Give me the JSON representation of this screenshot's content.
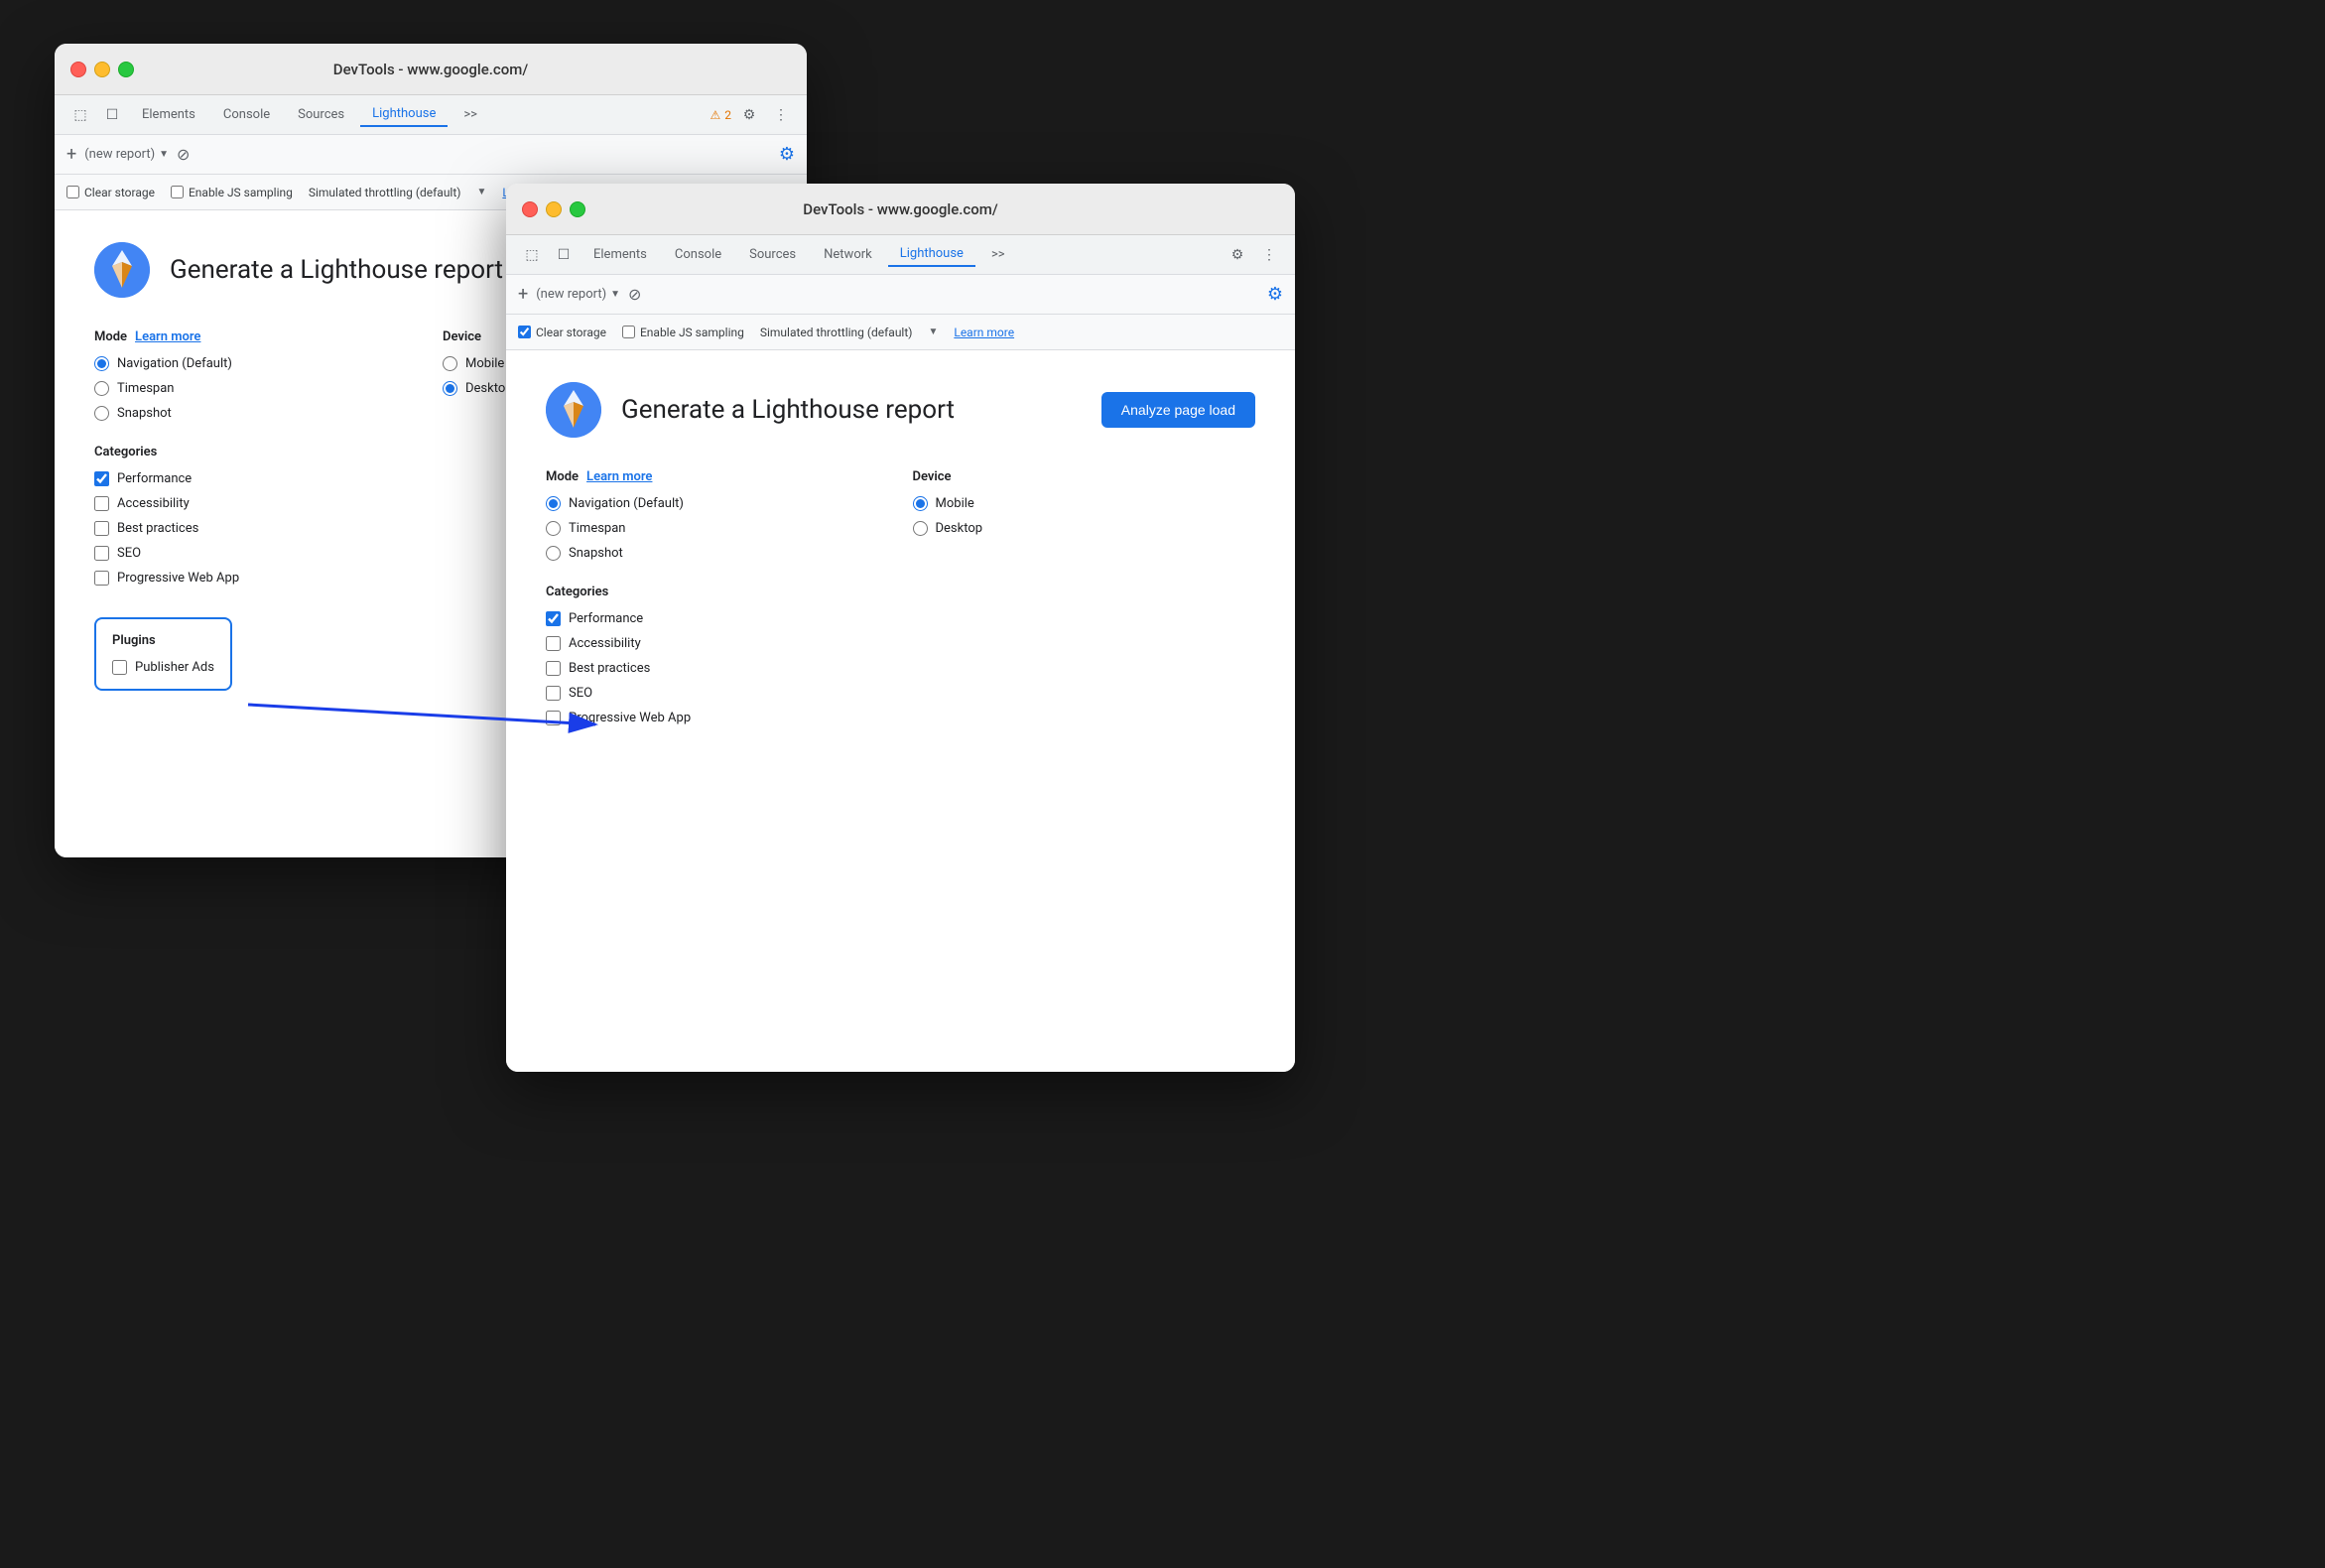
{
  "window1": {
    "titlebar": {
      "title": "DevTools - www.google.com/"
    },
    "tabs": {
      "items": [
        "Elements",
        "Console",
        "Sources",
        "Lighthouse",
        ">>"
      ],
      "active": "Lighthouse"
    },
    "warning": {
      "count": "2"
    },
    "lh_toolbar": {
      "new_report": "(new report)",
      "plus": "+",
      "clear": "⊘"
    },
    "options_bar": {
      "clear_storage": "Clear storage",
      "clear_storage_checked": false,
      "enable_js": "Enable JS sampling",
      "enable_js_checked": false,
      "throttling": "Simulated throttling (default)",
      "learn_more": "Learn more"
    },
    "main": {
      "title": "Generate a Lighthouse report",
      "mode_label": "Mode",
      "mode_learn_more": "Learn more",
      "device_label": "Device",
      "modes": [
        {
          "label": "Navigation (Default)",
          "checked": true
        },
        {
          "label": "Timespan",
          "checked": false
        },
        {
          "label": "Snapshot",
          "checked": false
        }
      ],
      "devices": [
        {
          "label": "Mobile",
          "checked": false
        },
        {
          "label": "Desktop",
          "checked": true
        }
      ],
      "categories_label": "Categories",
      "categories": [
        {
          "label": "Performance",
          "checked": true
        },
        {
          "label": "Accessibility",
          "checked": false
        },
        {
          "label": "Best practices",
          "checked": false
        },
        {
          "label": "SEO",
          "checked": false
        },
        {
          "label": "Progressive Web App",
          "checked": false
        }
      ],
      "plugins_label": "Plugins",
      "plugins": [
        {
          "label": "Publisher Ads",
          "checked": false
        }
      ]
    }
  },
  "window2": {
    "titlebar": {
      "title": "DevTools - www.google.com/"
    },
    "tabs": {
      "items": [
        "Elements",
        "Console",
        "Sources",
        "Network",
        "Lighthouse",
        ">>"
      ],
      "active": "Lighthouse"
    },
    "lh_toolbar": {
      "new_report": "(new report)",
      "plus": "+",
      "clear": "⊘"
    },
    "options_bar": {
      "clear_storage": "Clear storage",
      "clear_storage_checked": true,
      "enable_js": "Enable JS sampling",
      "enable_js_checked": false,
      "throttling": "Simulated throttling (default)",
      "learn_more": "Learn more"
    },
    "main": {
      "title": "Generate a Lighthouse report",
      "analyze_btn": "Analyze page load",
      "mode_label": "Mode",
      "mode_learn_more": "Learn more",
      "device_label": "Device",
      "modes": [
        {
          "label": "Navigation (Default)",
          "checked": true
        },
        {
          "label": "Timespan",
          "checked": false
        },
        {
          "label": "Snapshot",
          "checked": false
        }
      ],
      "devices": [
        {
          "label": "Mobile",
          "checked": true
        },
        {
          "label": "Desktop",
          "checked": false
        }
      ],
      "categories_label": "Categories",
      "categories": [
        {
          "label": "Performance",
          "checked": true
        },
        {
          "label": "Accessibility",
          "checked": false
        },
        {
          "label": "Best practices",
          "checked": false
        },
        {
          "label": "SEO",
          "checked": false
        },
        {
          "label": "Progressive Web App",
          "checked": false
        }
      ]
    }
  },
  "icons": {
    "gear": "⚙",
    "kebab": "⋮",
    "warning": "⚠",
    "cursor": "⬚",
    "inspector": "☐",
    "add": "+",
    "chevron_down": "▼",
    "circle_stop": "⊘"
  }
}
